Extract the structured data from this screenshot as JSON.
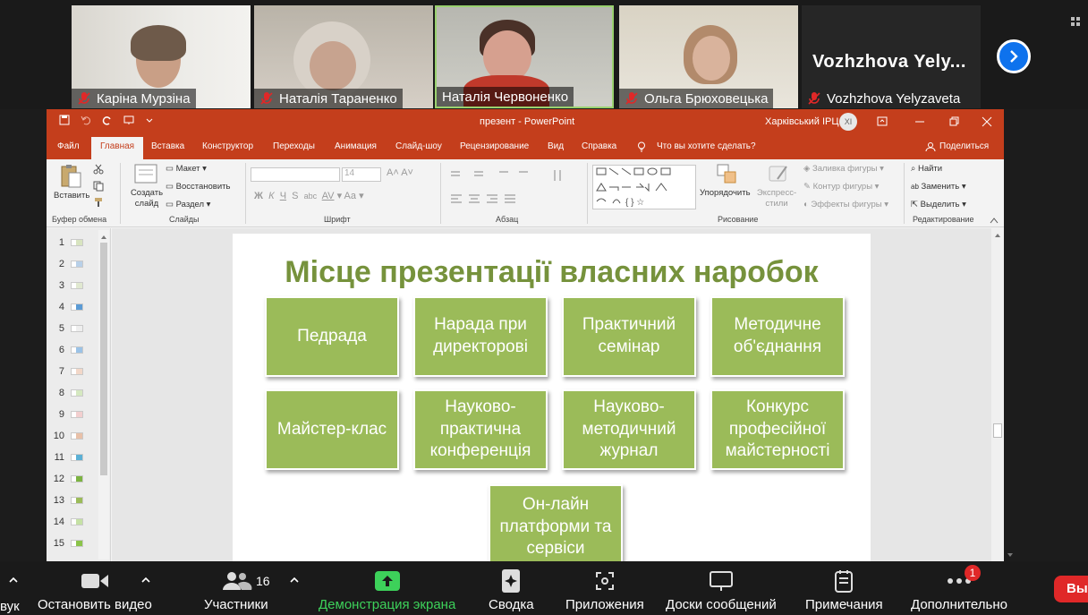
{
  "participants": [
    {
      "name": "Каріна Мурзіна"
    },
    {
      "name": "Наталія Тараненко"
    },
    {
      "name": "Наталія Червоненко"
    },
    {
      "name": "Ольга Брюховецька"
    },
    {
      "name": "Vozhzhova Yelyzaveta",
      "big_name": "Vozhzhova  Yely..."
    }
  ],
  "ppt": {
    "doc_title": "презент  -  PowerPoint",
    "user_org": "Харківський ІРЦ",
    "avatar_initials": "ХІ",
    "tabs": [
      "Файл",
      "Главная",
      "Вставка",
      "Конструктор",
      "Переходы",
      "Анимация",
      "Слайд-шоу",
      "Рецензирование",
      "Вид",
      "Справка",
      "Что вы хотите сделать?",
      "Поделиться"
    ],
    "ribbon": {
      "paste": "Вставить",
      "clipboard_group": "Буфер обмена",
      "create_slide": "Создать слайд",
      "layout": "Макет",
      "reset": "Восстановить",
      "section": "Раздел",
      "slides_group": "Слайды",
      "font_size": "14",
      "font_group": "Шрифт",
      "bold": "Ж",
      "italic": "К",
      "underline": "Ч",
      "strike": "S",
      "abc": "abc",
      "spacing": "AV",
      "case": "Aa",
      "paragraph_group": "Абзац",
      "arrange": "Упорядочить",
      "quick_styles": "Экспресс-стили",
      "shape_fill": "Заливка фигуры",
      "shape_outline": "Контур фигуры",
      "shape_effects": "Эффекты фигуры",
      "drawing_group": "Рисование",
      "find": "Найти",
      "replace": "Заменить",
      "select": "Выделить",
      "editing_group": "Редактирование"
    },
    "slide_numbers": [
      "1",
      "2",
      "3",
      "4",
      "5",
      "6",
      "7",
      "8",
      "9",
      "10",
      "11",
      "12",
      "13",
      "14",
      "15"
    ],
    "slide": {
      "title": "Місце презентації власних наробок",
      "boxes": [
        "Педрада",
        "Нарада при директорові",
        "Практичний семінар",
        "Методичне об'єднання",
        "Майстер-клас",
        "Науково-практична конференція",
        "Науково-методичний журнал",
        "Конкурс професійної майстерності",
        "Он-лайн платформи та сервіси"
      ]
    }
  },
  "toolbar": {
    "sound": "вук",
    "stop_video": "Остановить видео",
    "participants": "Участники",
    "participants_count": "16",
    "share_screen": "Демонстрация экрана",
    "summary": "Сводка",
    "apps": "Приложения",
    "whiteboards": "Доски сообщений",
    "notes": "Примечания",
    "more": "Дополнительно",
    "more_badge": "1",
    "leave": "Вы"
  },
  "colors": {
    "ppt_red": "#c43e1c",
    "slide_green": "#9bbb59",
    "title_green": "#76923c",
    "share_green": "#3dd15a",
    "zoom_blue": "#0e72ed"
  }
}
